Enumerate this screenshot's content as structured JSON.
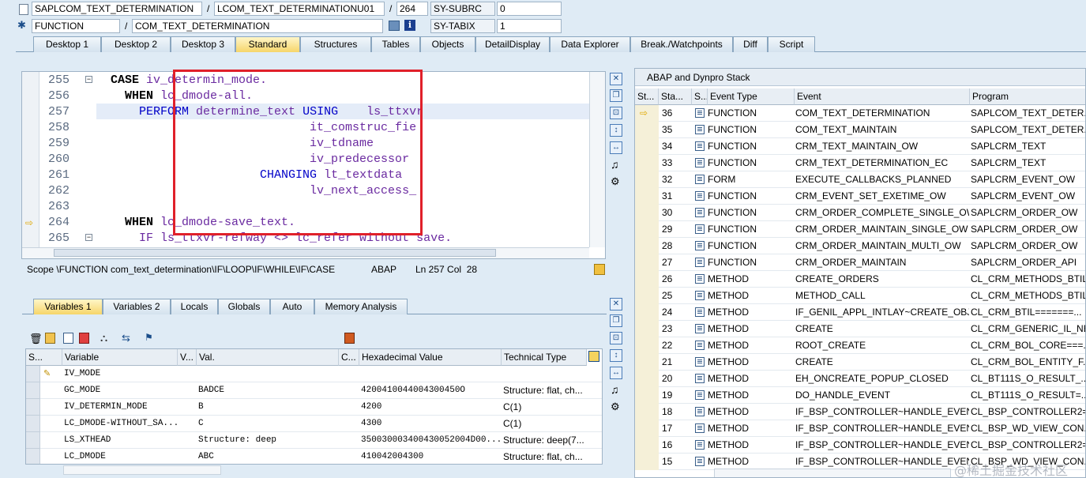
{
  "header": {
    "program_field": "SAPLCOM_TEXT_DETERMINATION",
    "include_field": "LCOM_TEXT_DETERMINATIONU01",
    "line_field": "264",
    "sysvar1_name": "SY-SUBRC",
    "sysvar1_value": "0",
    "type_field": "FUNCTION",
    "name_field": "COM_TEXT_DETERMINATION",
    "sysvar2_name": "SY-TABIX",
    "sysvar2_value": "1",
    "slash": "/"
  },
  "tabs": [
    "Desktop 1",
    "Desktop 2",
    "Desktop 3",
    "Standard",
    "Structures",
    "Tables",
    "Objects",
    "DetailDisplay",
    "Data Explorer",
    "Break./Watchpoints",
    "Diff",
    "Script"
  ],
  "code": {
    "lines": [
      {
        "num": "255",
        "a": "  ",
        "b": "CASE",
        "c": " iv_determin_mode."
      },
      {
        "num": "256",
        "a": "    ",
        "b": "WHEN",
        "c": " lc_dmode-all."
      },
      {
        "num": "257",
        "a": "      ",
        "k": "PERFORM",
        "c": " determine_text ",
        "k2": "USING",
        "d": "    ls_ttxvr"
      },
      {
        "num": "258",
        "c": "                              it_comstruc_fie"
      },
      {
        "num": "259",
        "c": "                              iv_tdname"
      },
      {
        "num": "260",
        "c": "                              iv_predecessor"
      },
      {
        "num": "261",
        "c": "                       ",
        "k": "CHANGING",
        "d": " lt_textdata"
      },
      {
        "num": "262",
        "c": "                              lv_next_access_"
      },
      {
        "num": "263",
        "c": ""
      },
      {
        "num": "264",
        "a": "    ",
        "b": "WHEN",
        "c": " lc_dmode-save_text."
      },
      {
        "num": "265",
        "c": "      IF ls_ttxvr-refway <> lc_refer without save."
      }
    ]
  },
  "status_bar": {
    "scope": "Scope \\FUNCTION com_text_determination\\IF\\LOOP\\IF\\WHILE\\IF\\CASE",
    "lang": "ABAP",
    "position": "Ln 257 Col  28"
  },
  "var_tabs": [
    "Variables 1",
    "Variables 2",
    "Locals",
    "Globals",
    "Auto",
    "Memory Analysis"
  ],
  "variables": {
    "headers": [
      "S...",
      "Variable",
      "V...",
      "Val.",
      "C...",
      "Hexadecimal Value",
      "Technical Type"
    ],
    "rows": [
      {
        "name": "IV_MODE",
        "val": "",
        "hex": "",
        "type": ""
      },
      {
        "name": "GC_MODE",
        "val": "BADCE",
        "hex": "4200410044004300450O",
        "type": "Structure: flat, ch..."
      },
      {
        "name": "IV_DETERMIN_MODE",
        "val": "B",
        "hex": "4200",
        "type": "C(1)"
      },
      {
        "name": "LC_DMODE-WITHOUT_SA...",
        "val": "C",
        "hex": "4300",
        "type": "C(1)"
      },
      {
        "name": "LS_XTHEAD",
        "val": "Structure: deep",
        "hex": "350030003400430052004D00...",
        "type": "Structure: deep(7..."
      },
      {
        "name": "LC_DMODE",
        "val": "ABC",
        "hex": "410042004300",
        "type": "Structure: flat, ch..."
      }
    ]
  },
  "stack": {
    "title": "ABAP and Dynpro Stack",
    "headers": [
      "St...",
      "Sta...",
      "S...",
      "Event Type",
      "Event",
      "Program"
    ],
    "rows": [
      {
        "level": "36",
        "type": "FUNCTION",
        "event": "COM_TEXT_DETERMINATION",
        "program": "SAPLCOM_TEXT_DETER..."
      },
      {
        "level": "35",
        "type": "FUNCTION",
        "event": "COM_TEXT_MAINTAIN",
        "program": "SAPLCOM_TEXT_DETER..."
      },
      {
        "level": "34",
        "type": "FUNCTION",
        "event": "CRM_TEXT_MAINTAIN_OW",
        "program": "SAPLCRM_TEXT"
      },
      {
        "level": "33",
        "type": "FUNCTION",
        "event": "CRM_TEXT_DETERMINATION_EC",
        "program": "SAPLCRM_TEXT"
      },
      {
        "level": "32",
        "type": "FORM",
        "event": "EXECUTE_CALLBACKS_PLANNED",
        "program": "SAPLCRM_EVENT_OW"
      },
      {
        "level": "31",
        "type": "FUNCTION",
        "event": "CRM_EVENT_SET_EXETIME_OW",
        "program": "SAPLCRM_EVENT_OW"
      },
      {
        "level": "30",
        "type": "FUNCTION",
        "event": "CRM_ORDER_COMPLETE_SINGLE_OW",
        "program": "SAPLCRM_ORDER_OW"
      },
      {
        "level": "29",
        "type": "FUNCTION",
        "event": "CRM_ORDER_MAINTAIN_SINGLE_OW",
        "program": "SAPLCRM_ORDER_OW"
      },
      {
        "level": "28",
        "type": "FUNCTION",
        "event": "CRM_ORDER_MAINTAIN_MULTI_OW",
        "program": "SAPLCRM_ORDER_OW"
      },
      {
        "level": "27",
        "type": "FUNCTION",
        "event": "CRM_ORDER_MAINTAIN",
        "program": "SAPLCRM_ORDER_API"
      },
      {
        "level": "26",
        "type": "METHOD",
        "event": "CREATE_ORDERS",
        "program": "CL_CRM_METHODS_BTIL..."
      },
      {
        "level": "25",
        "type": "METHOD",
        "event": "METHOD_CALL",
        "program": "CL_CRM_METHODS_BTIL..."
      },
      {
        "level": "24",
        "type": "METHOD",
        "event": "IF_GENIL_APPL_INTLAY~CREATE_OBJ...",
        "program": "CL_CRM_BTIL=======..."
      },
      {
        "level": "23",
        "type": "METHOD",
        "event": "CREATE",
        "program": "CL_CRM_GENERIC_IL_NE..."
      },
      {
        "level": "22",
        "type": "METHOD",
        "event": "ROOT_CREATE",
        "program": "CL_CRM_BOL_CORE===..."
      },
      {
        "level": "21",
        "type": "METHOD",
        "event": "CREATE",
        "program": "CL_CRM_BOL_ENTITY_F..."
      },
      {
        "level": "20",
        "type": "METHOD",
        "event": "EH_ONCREATE_POPUP_CLOSED",
        "program": "CL_BT111S_O_RESULT_..."
      },
      {
        "level": "19",
        "type": "METHOD",
        "event": "DO_HANDLE_EVENT",
        "program": "CL_BT111S_O_RESULT=..."
      },
      {
        "level": "18",
        "type": "METHOD",
        "event": "IF_BSP_CONTROLLER~HANDLE_EVENT",
        "program": "CL_BSP_CONTROLLER2=..."
      },
      {
        "level": "17",
        "type": "METHOD",
        "event": "IF_BSP_CONTROLLER~HANDLE_EVENT",
        "program": "CL_BSP_WD_VIEW_CON..."
      },
      {
        "level": "16",
        "type": "METHOD",
        "event": "IF_BSP_CONTROLLER~HANDLE_EVENT",
        "program": "CL_BSP_CONTROLLER2=..."
      },
      {
        "level": "15",
        "type": "METHOD",
        "event": "IF_BSP_CONTROLLER~HANDLE_EVENT",
        "program": "CL_BSP_WD_VIEW_CON..."
      }
    ]
  },
  "watermark": "@稀土掘金技术社区",
  "colors": {
    "highlight_box": "#e0202a",
    "active_tab": "#f6d56a",
    "keyword": "#0000c8",
    "code_text": "#6a2aa0"
  }
}
